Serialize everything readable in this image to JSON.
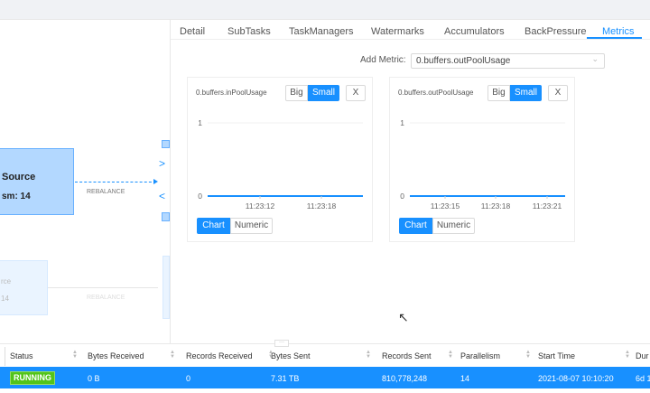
{
  "tabs": [
    "Detail",
    "SubTasks",
    "TaskManagers",
    "Watermarks",
    "Accumulators",
    "BackPressure",
    "Metrics"
  ],
  "active_tab": "Metrics",
  "add_metric": {
    "label": "Add Metric:",
    "value": "0.buffers.outPoolUsage"
  },
  "graph": {
    "node_title": "Source",
    "node_parallelism": "sm: 14",
    "edge_label": "REBALANCE",
    "faded_title": "rce",
    "faded_parallelism": "14",
    "faded_edge_label": "REBALANCE"
  },
  "cards": [
    {
      "title": "0.buffers.inPoolUsage",
      "big": "Big",
      "small": "Small",
      "close": "X",
      "chart": "Chart",
      "numeric": "Numeric"
    },
    {
      "title": "0.buffers.outPoolUsage",
      "big": "Big",
      "small": "Small",
      "close": "X",
      "chart": "Chart",
      "numeric": "Numeric"
    }
  ],
  "chart_data": [
    {
      "type": "line",
      "yticks": [
        "1",
        "0"
      ],
      "ylim": [
        0,
        1
      ],
      "xticks": [
        "11:23:12",
        "11:23:18"
      ],
      "values": [
        0,
        0
      ],
      "color": "#1890ff"
    },
    {
      "type": "line",
      "yticks": [
        "1",
        "0"
      ],
      "ylim": [
        0,
        1
      ],
      "xticks": [
        "11:23:15",
        "11:23:18",
        "11:23:21"
      ],
      "values": [
        0,
        0
      ],
      "color": "#1890ff"
    }
  ],
  "table": {
    "headers": [
      "Status",
      "Bytes Received",
      "Records Received",
      "Bytes Sent",
      "Records Sent",
      "Parallelism",
      "Start Time",
      "Dur"
    ],
    "row": {
      "status": "RUNNING",
      "bytes_received": "0 B",
      "records_received": "0",
      "bytes_sent": "7.31 TB",
      "records_sent": "810,778,248",
      "parallelism": "14",
      "start_time": "2021-08-07 10:10:20",
      "duration": "6d 1"
    }
  },
  "colors": {
    "accent": "#1890ff",
    "running": "#52c41a"
  }
}
